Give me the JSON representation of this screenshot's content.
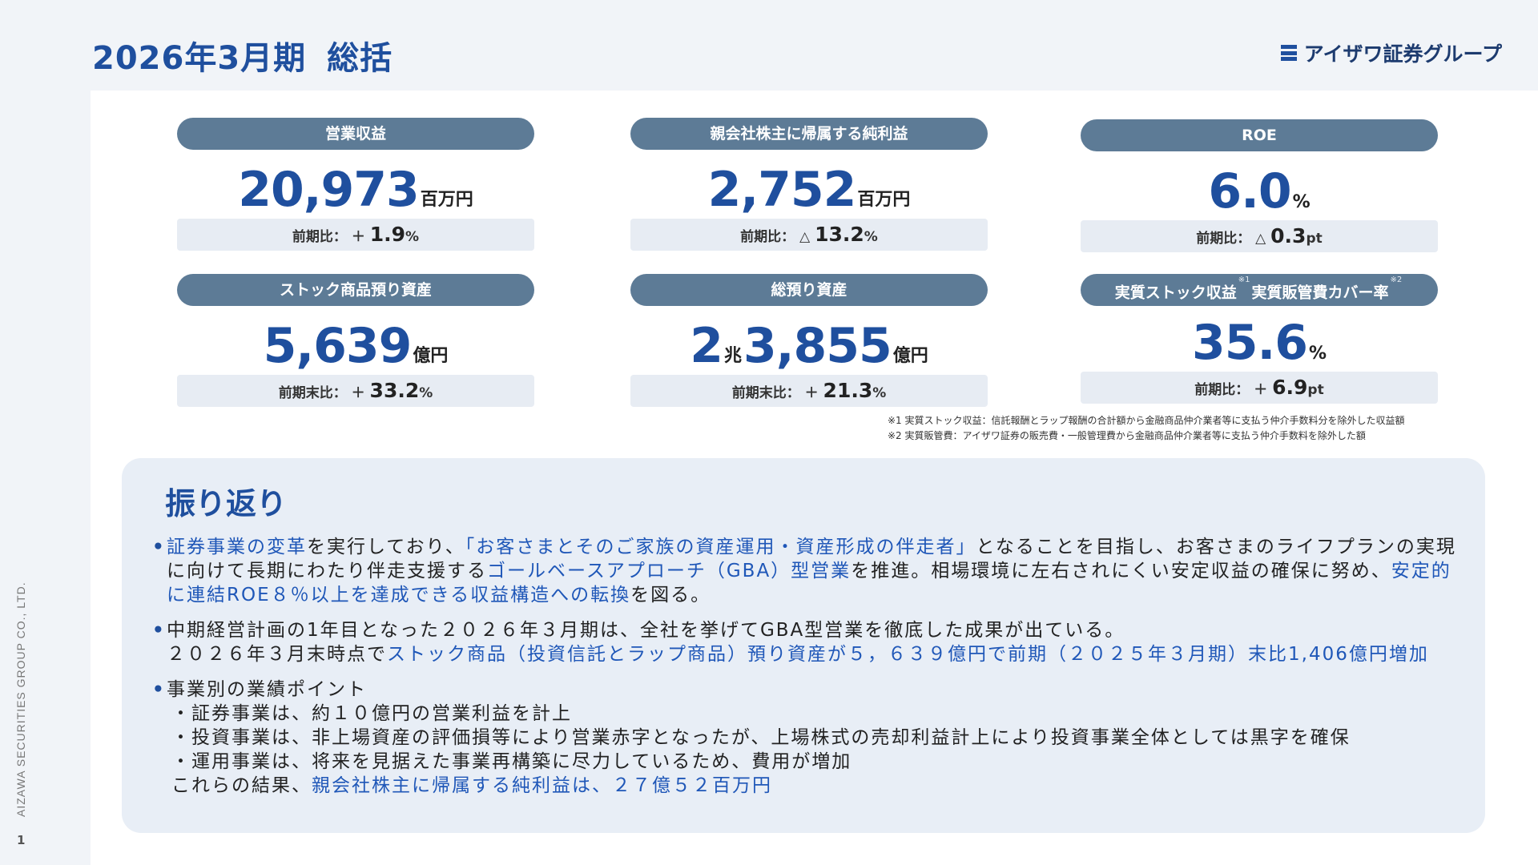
{
  "header": {
    "title_period": "2026年3月期",
    "title_main": "総括",
    "brand": "アイザワ証券グループ"
  },
  "sidebar": {
    "company": "AIZAWA SECURITIES GROUP CO., LTD.",
    "page_number": "1"
  },
  "kpis": [
    {
      "label": "営業収益",
      "prefix_num": "",
      "mid_unit": "",
      "value": "20,973",
      "unit": "百万円",
      "change_label": "前期比：",
      "change_sign": "＋",
      "change_value": "1.9",
      "change_unit": "%"
    },
    {
      "label": "親会社株主に帰属する純利益",
      "prefix_num": "",
      "mid_unit": "",
      "value": "2,752",
      "unit": "百万円",
      "change_label": "前期比：",
      "change_sign": "△",
      "change_value": "13.2",
      "change_unit": "%"
    },
    {
      "label": "ROE",
      "prefix_num": "",
      "mid_unit": "",
      "value": "6.0",
      "unit": "%",
      "change_label": "前期比：",
      "change_sign": "△",
      "change_value": "0.3",
      "change_unit": "pt"
    },
    {
      "label": "ストック商品預り資産",
      "prefix_num": "",
      "mid_unit": "",
      "value": "5,639",
      "unit": "億円",
      "change_label": "前期末比：",
      "change_sign": "＋",
      "change_value": "33.2",
      "change_unit": "%"
    },
    {
      "label": "総預り資産",
      "prefix_num": "2",
      "mid_unit": "兆",
      "value": "3,855",
      "unit": "億円",
      "change_label": "前期末比：",
      "change_sign": "＋",
      "change_value": "21.3",
      "change_unit": "%"
    },
    {
      "label_a": "実質ストック収益",
      "label_note_a": "※1",
      "label_b": "実質販管費カバー率",
      "label_note_b": "※2",
      "prefix_num": "",
      "mid_unit": "",
      "value": "35.6",
      "unit": "%",
      "change_label": "前期比：",
      "change_sign": "＋",
      "change_value": "6.9",
      "change_unit": "pt"
    }
  ],
  "notes": [
    "※1 実質ストック収益：信託報酬とラップ報酬の合計額から金融商品仲介業者等に支払う仲介手数料分を除外した収益額",
    "※2 実質販管費：アイザワ証券の販売費・一般管理費から金融商品仲介業者等に支払う仲介手数料を除外した額"
  ],
  "review": {
    "title": "振り返り",
    "b1": {
      "hl1": "証券事業の変革",
      "t1": "を実行しており、",
      "hl2": "「お客さまとそのご家族の資産運用・資産形成の伴走者」",
      "t2": "となることを目指し、お客さまのライフプランの実現に向けて長期にわたり伴走支援する",
      "hl3": "ゴールベースアプローチ（GBA）型営業",
      "t3": "を推進。相場環境に左右されにくい安定収益の確保に努め、",
      "hl4": "安定的に連結ROE８％以上を達成できる収益構造への転換",
      "t4": "を図る。"
    },
    "b2": {
      "line1": "中期経営計画の1年目となった２０２６年３月期は、全社を挙げてGBA型営業を徹底した成果が出ている。",
      "t1": "２０２６年３月末時点で",
      "hl1": "ストック商品（投資信託とラップ商品）預り資産が５，６３９億円で前期（２０２５年３月期）末比1,406億円増加"
    },
    "b3": {
      "head": "事業別の業績ポイント",
      "items": [
        "・証券事業は、約１０億円の営業利益を計上",
        "・投資事業は、非上場資産の評価損等により営業赤字となったが、上場株式の売却利益計上により投資事業全体としては黒字を確保",
        "・運用事業は、将来を見据えた事業再構築に尽力しているため、費用が増加"
      ],
      "result_pre": "これらの結果、",
      "result_hl": "親会社株主に帰属する純利益は、２７億５２百万円"
    }
  }
}
